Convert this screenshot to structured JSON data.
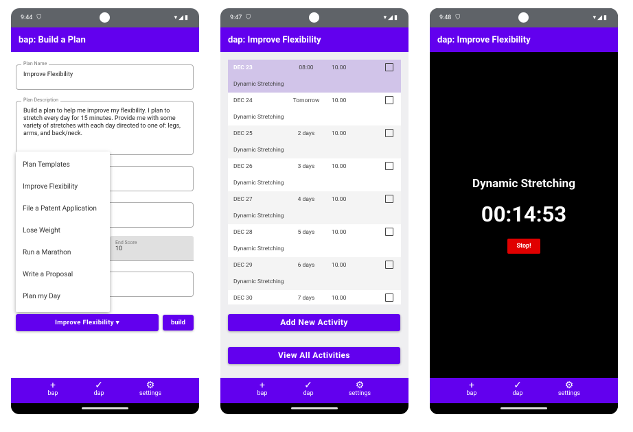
{
  "screens": [
    {
      "time": "9:44",
      "title": "bap: Build a Plan"
    },
    {
      "time": "9:47",
      "title": "dap: Improve Flexibility"
    },
    {
      "time": "9:48",
      "title": "dap: Improve Flexibility"
    }
  ],
  "status_icons": "▾◢▮",
  "nav": [
    {
      "icon": "plus-icon",
      "glyph": "+",
      "label": "bap"
    },
    {
      "icon": "check-icon",
      "glyph": "✓",
      "label": "dap"
    },
    {
      "icon": "gear-icon",
      "glyph": "⚙",
      "label": "settings"
    }
  ],
  "bap": {
    "plan_name_label": "Plan Name",
    "plan_name": "Improve Flexibility",
    "plan_desc_label": "Plan Description",
    "plan_desc": "Build a plan to help me improve my flexibility. I plan to stretch every day for 15 minutes. Provide me with some variety of stretches with each day directed to one of: legs, arms, and back/neck.",
    "end_score_label": "End Score",
    "end_score": "10",
    "menu": [
      "Plan Templates",
      "Improve Flexibility",
      "File a Patent Application",
      "Lose Weight",
      "Run a Marathon",
      "Write a Proposal",
      "Plan my Day"
    ],
    "template_button": "Improve Flexibility ▾",
    "build_button": "build"
  },
  "dap": {
    "activities": [
      {
        "date": "DEC 23",
        "when": "08:00",
        "score": "10.00",
        "name": "Dynamic Stretching",
        "checked": false
      },
      {
        "date": "DEC 24",
        "when": "Tomorrow",
        "score": "10.00",
        "name": "Dynamic Stretching",
        "checked": false
      },
      {
        "date": "DEC 25",
        "when": "2 days",
        "score": "10.00",
        "name": "Dynamic Stretching",
        "checked": false
      },
      {
        "date": "DEC 26",
        "when": "3 days",
        "score": "10.00",
        "name": "Dynamic Stretching",
        "checked": false
      },
      {
        "date": "DEC 27",
        "when": "4 days",
        "score": "10.00",
        "name": "Dynamic Stretching",
        "checked": false
      },
      {
        "date": "DEC 28",
        "when": "5 days",
        "score": "10.00",
        "name": "Dynamic Stretching",
        "checked": false
      },
      {
        "date": "DEC 29",
        "when": "6 days",
        "score": "10.00",
        "name": "Dynamic Stretching",
        "checked": false
      },
      {
        "date": "DEC 30",
        "when": "7 days",
        "score": "10.00",
        "name": "",
        "checked": false
      }
    ],
    "add_button": "Add New Activity",
    "view_button": "View All Activities"
  },
  "timer": {
    "activity": "Dynamic Stretching",
    "time": "00:14:53",
    "stop_button": "Stop!"
  },
  "colors": {
    "primary": "#6200ee",
    "highlight": "#d1c4e9",
    "stop": "#e00000"
  }
}
